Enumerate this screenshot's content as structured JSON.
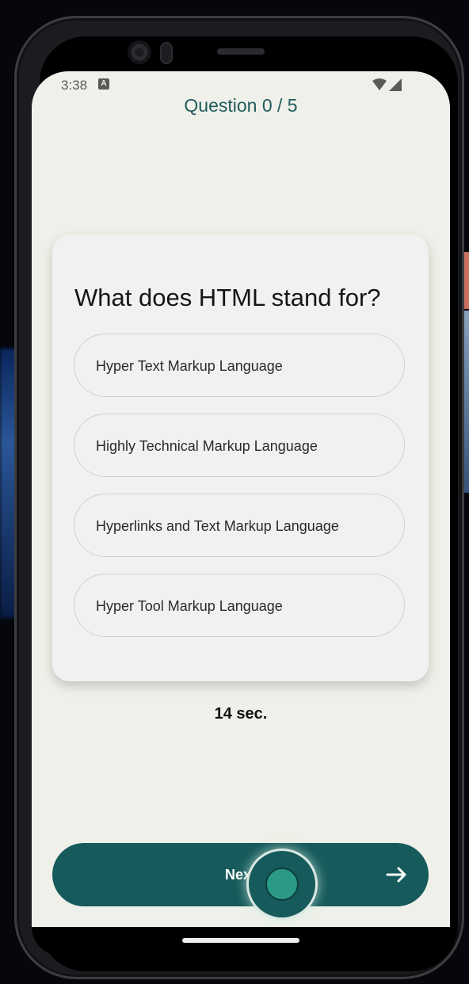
{
  "status_bar": {
    "time": "3:38",
    "notification_letter": "A"
  },
  "quiz": {
    "counter": "Question 0 / 5",
    "question": "What does HTML stand for?",
    "options": [
      "Hyper Text Markup Language",
      "Highly Technical Markup Language",
      "Hyperlinks and Text Markup Language",
      "Hyper Tool Markup Language"
    ],
    "timer": "14 sec."
  },
  "footer": {
    "next_label": "Next"
  },
  "colors": {
    "accent": "#175a5b",
    "screen_bg": "#eff0e9",
    "card_bg": "#f1f1f1"
  },
  "icons": [
    "wifi-icon",
    "signal-icon",
    "arrow-right-icon"
  ]
}
